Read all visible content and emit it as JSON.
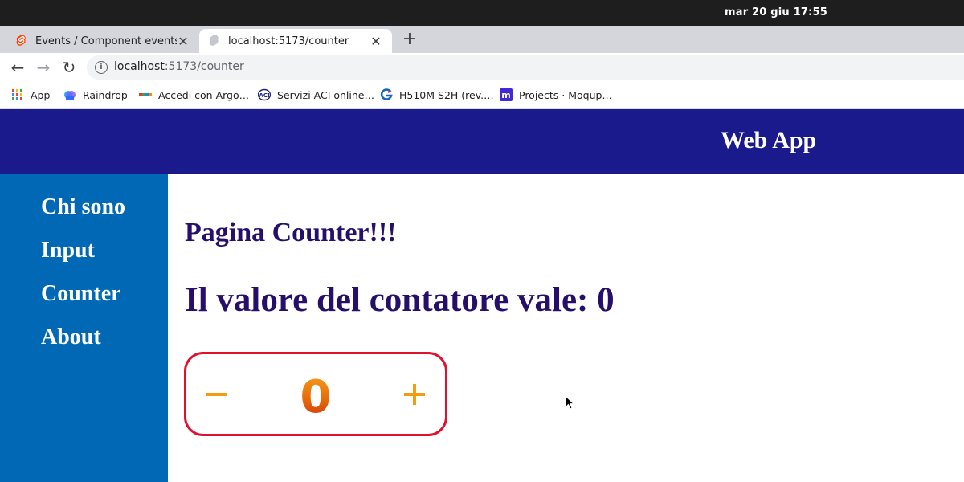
{
  "os": {
    "clock": "mar 20 giu  17:55"
  },
  "tabs": [
    {
      "title": "Events / Component events • S",
      "favicon": "svelte-icon",
      "active": false
    },
    {
      "title": "localhost:5173/counter",
      "favicon": "globe-icon",
      "active": true
    }
  ],
  "address_bar": {
    "host": "localhost",
    "path": ":5173/counter"
  },
  "bookmarks": [
    {
      "label": "App",
      "icon": "apps-grid-icon"
    },
    {
      "label": "Raindrop",
      "icon": "raindrop-icon"
    },
    {
      "label": "Accedi con Argo…",
      "icon": "argo-icon"
    },
    {
      "label": "Servizi ACI online…",
      "icon": "aci-icon"
    },
    {
      "label": "H510M S2H (rev.…",
      "icon": "gigabyte-icon"
    },
    {
      "label": "Projects · Moqup…",
      "icon": "moqups-icon"
    }
  ],
  "app": {
    "title": "Web App",
    "nav": [
      "Chi sono",
      "Input",
      "Counter",
      "About"
    ],
    "heading": "Pagina Counter!!!",
    "counter_label": "Il valore del contatore vale: 0",
    "counter_value": "0"
  },
  "colors": {
    "header": "#1a1a8c",
    "sidebar": "#0068b5",
    "heading_text": "#250f6b",
    "counter_border": "#e0102e",
    "counter_buttons": "#f39c12",
    "counter_digit": "#d65b00"
  }
}
